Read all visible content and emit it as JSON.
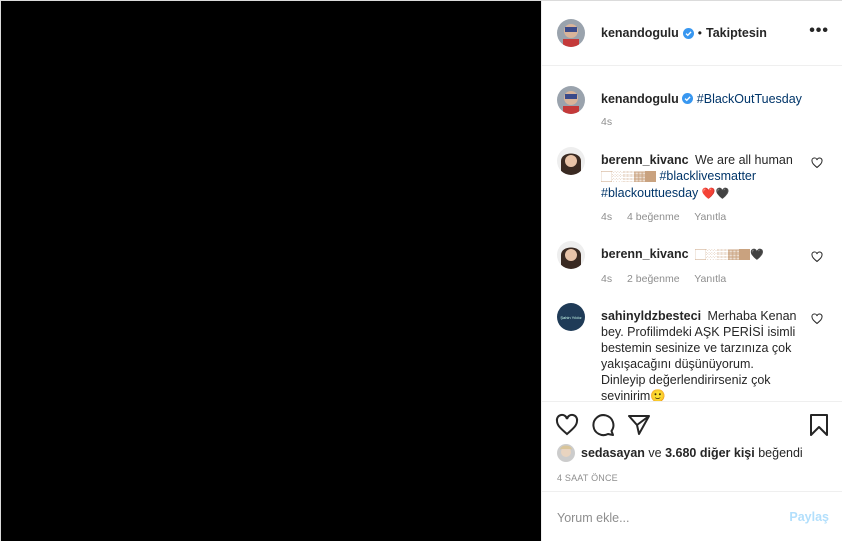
{
  "header": {
    "username": "kenandogulu",
    "dot": "•",
    "follow_label": "Takiptesin",
    "more_label": "•••"
  },
  "caption": {
    "username": "kenandogulu",
    "hashtag": "#BlackOutTuesday",
    "time": "4s"
  },
  "comments": [
    {
      "username": "berenn_kivanc",
      "text": "We are all human",
      "emoji": "🏻🏼🏽🏾🏿",
      "hashtag1": "#blacklivesmatter",
      "hashtag2": "#blackouttuesday",
      "hearts": "❤️🖤",
      "time": "4s",
      "likes": "4 beğenme",
      "reply": "Yanıtla"
    },
    {
      "username": "berenn_kivanc",
      "emoji": "🏻🏼🏽🏾🏿🖤",
      "time": "4s",
      "likes": "2 beğenme",
      "reply": "Yanıtla"
    },
    {
      "username": "sahinyldzbesteci",
      "text": "Merhaba Kenan bey. Profilimdeki AŞK PERİSİ isimli bestemin sesinize ve tarzınıza çok yakışacağını düşünüyorum. Dinleyip değerlendirirseniz çok sevinirim🙂",
      "avatar_text": "Şahin Yıldız"
    }
  ],
  "likes": {
    "user": "sedasayan",
    "connector": " ve ",
    "others": "3.680 diğer kişi",
    "suffix": " beğendi"
  },
  "timestamp": "4 SAAT ÖNCE",
  "add_comment": {
    "placeholder": "Yorum ekle...",
    "post_label": "Paylaş"
  },
  "colors": {
    "hashtag": "#003569",
    "verified": "#3897f0",
    "post_disabled": "#b2dffc",
    "muted": "#8e8e8e"
  },
  "icons": [
    "verified-badge-icon",
    "heart-icon",
    "comment-icon",
    "share-icon",
    "bookmark-icon",
    "more-options-icon"
  ]
}
